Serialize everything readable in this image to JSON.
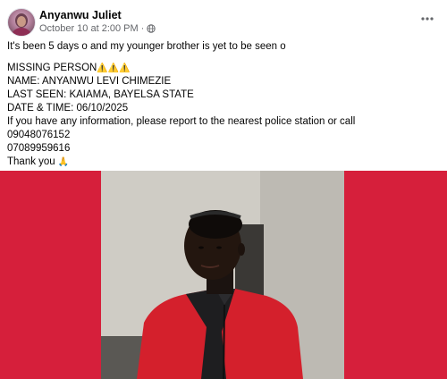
{
  "post": {
    "author": "Anyanwu Juliet",
    "timestamp": "October 10 at 2:00 PM",
    "separator": "·",
    "more_icon": "more-horizontal-icon",
    "privacy_icon": "globe-icon",
    "intro": "It's been 5 days o and my younger brother is yet to be seen o",
    "lines": {
      "missing": "MISSING PERSON",
      "missing_emoji": "⚠️⚠️⚠️",
      "name": "NAME: ANYANWU LEVI CHIMEZIE",
      "last_seen": "LAST SEEN: KAIAMA, BAYELSA STATE",
      "date_time": "DATE & TIME: 06/10/2025",
      "info": "If you have any information, please report to the nearest police station or call",
      "phone1": "09048076152",
      "phone2": "07089959616",
      "thanks": "Thank you",
      "thanks_emoji": "🙏"
    }
  },
  "colors": {
    "background_red": "#d61f3b",
    "jacket_red": "#d4202c",
    "meta_gray": "#65676b"
  }
}
